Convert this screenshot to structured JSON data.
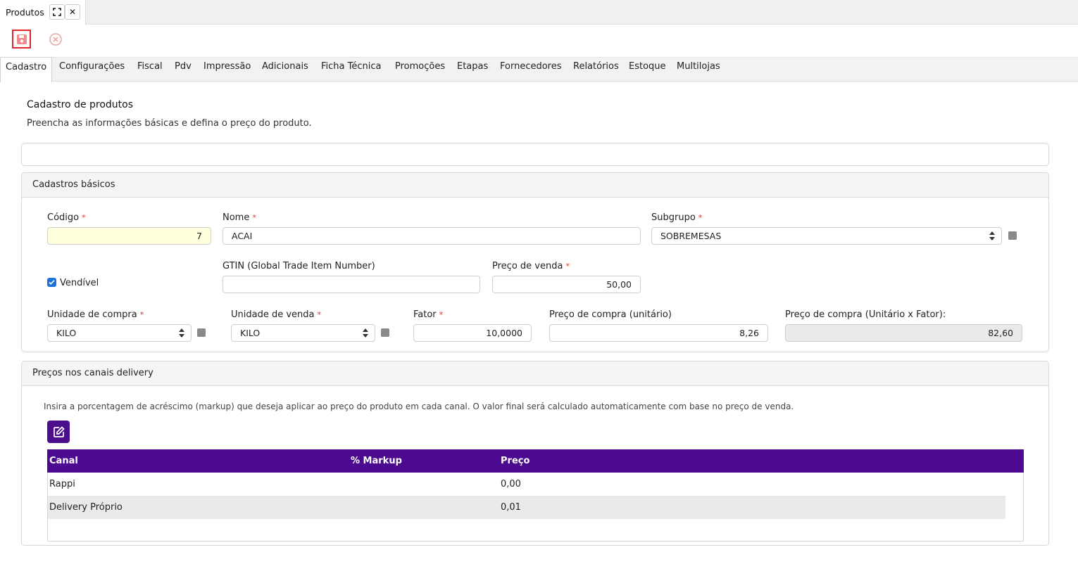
{
  "window": {
    "tab_title": "Produtos",
    "maximize_icon": "maximize-icon",
    "close_symbol": "✕"
  },
  "toolbar": {
    "save_icon": "save-icon",
    "cancel_icon": "cancel-circle-icon"
  },
  "nav": {
    "tabs": [
      {
        "label": "Cadastro",
        "active": true
      },
      {
        "label": "Configurações"
      },
      {
        "label": "Fiscal"
      },
      {
        "label": "Pdv"
      },
      {
        "label": "Impressão"
      },
      {
        "label": "Adicionais"
      },
      {
        "label": "Ficha Técnica"
      },
      {
        "label": "Promoções"
      },
      {
        "label": "Etapas"
      },
      {
        "label": "Fornecedores"
      },
      {
        "label": "Relatórios"
      },
      {
        "label": "Estoque"
      },
      {
        "label": "Multilojas"
      }
    ]
  },
  "page": {
    "title": "Cadastro de produtos",
    "subtitle": "Preencha as informações básicas e defina o preço do produto."
  },
  "basic": {
    "header": "Cadastros básicos",
    "codigo": {
      "label": "Código",
      "required": "*",
      "value": "7"
    },
    "nome": {
      "label": "Nome",
      "required": "*",
      "value": "ACAI"
    },
    "subgrupo": {
      "label": "Subgrupo",
      "required": "*",
      "value": "SOBREMESAS"
    },
    "vendivel": {
      "label": "Vendível",
      "checked": true
    },
    "gtin": {
      "label": "GTIN (Global Trade Item Number)",
      "value": ""
    },
    "preco_venda": {
      "label": "Preço de venda",
      "required": "*",
      "value": "50,00"
    },
    "unidade_compra": {
      "label": "Unidade de compra",
      "required": "*",
      "value": "KILO"
    },
    "unidade_venda": {
      "label": "Unidade de venda",
      "required": "*",
      "value": "KILO"
    },
    "fator": {
      "label": "Fator",
      "required": "*",
      "value": "10,0000"
    },
    "preco_compra": {
      "label": "Preço de compra (unitário)",
      "value": "8,26"
    },
    "preco_compra_total": {
      "label": "Preço de compra (Unitário x Fator):",
      "value": "82,60"
    }
  },
  "delivery": {
    "header": "Preços nos canais delivery",
    "description": "Insira a porcentagem de acréscimo (markup) que deseja aplicar ao preço do produto em cada canal. O valor final será calculado automaticamente com base no preço de venda.",
    "edit_icon": "edit-icon",
    "columns": [
      "Canal",
      "% Markup",
      "Preço"
    ],
    "rows": [
      {
        "canal": "Rappi",
        "markup": "",
        "preco": "0,00"
      },
      {
        "canal": "Delivery Próprio",
        "markup": "",
        "preco": "0,01"
      }
    ]
  },
  "colors": {
    "accent_purple": "#4b0a8f",
    "required_red": "#d9342b",
    "save_red": "#e0262b",
    "checkbox_blue": "#1b72d8"
  }
}
